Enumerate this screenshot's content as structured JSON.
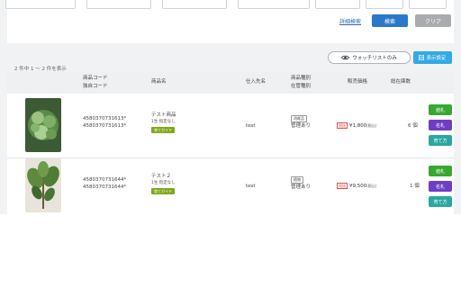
{
  "search": {
    "detail_link": "詳細検索",
    "search_button": "検索",
    "clear_button": "クリア"
  },
  "list": {
    "count_text": "2 件中 1 ～ 2 件を表示",
    "watchlist_button": "ウォッチリストのみ",
    "display_settings_button": "表示設定"
  },
  "columns": {
    "code": "商品コード",
    "own_code": "独自コード",
    "name": "商品名",
    "supplier": "仕入先名",
    "product_type": "商品種別",
    "stock_mgmt": "在管種別",
    "price": "販売価格",
    "stock": "総在庫数"
  },
  "rows": [
    {
      "code": "4580370731613*",
      "own_code": "4580370731613*",
      "name": "テスト商品",
      "spec": "1生 指定なし",
      "guide_tag": "育てガイド",
      "supplier": "test",
      "type_tag": "消耗品",
      "stock_mgmt": "管理あり",
      "tax_tag": "税抜",
      "price": "¥1,800",
      "price_note": "(税込)",
      "stock": "6 個",
      "tag_button": "値札",
      "name_button": "名札",
      "care_button": "育て方"
    },
    {
      "code": "4580370731644*",
      "own_code": "4580370731644*",
      "name": "テスト２",
      "spec": "1生 指定なし",
      "guide_tag": "育てガイド",
      "supplier": "test",
      "type_tag": "植物",
      "stock_mgmt": "管理あり",
      "tax_tag": "税抜",
      "price": "¥9,500",
      "price_note": "(税込)",
      "stock": "1 個",
      "tag_button": "値札",
      "name_button": "名札",
      "care_button": "育て方"
    }
  ],
  "colors": {
    "search": "#2a78c8",
    "clear": "#a9abae",
    "tag_button": "#38a832",
    "name_button": "#6c3fc3",
    "care_button": "#2aa8a0",
    "guide_tag": "#7fa81c"
  }
}
